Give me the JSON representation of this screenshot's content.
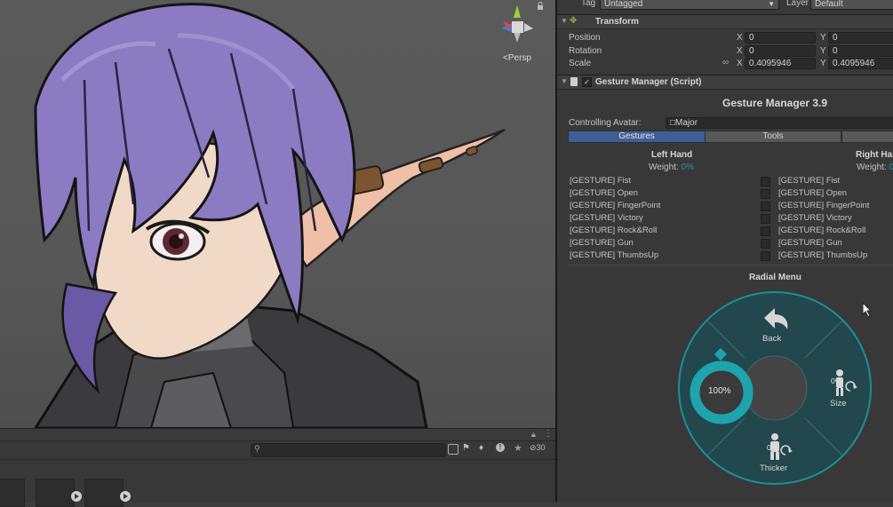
{
  "scene": {
    "persp_label": "Persp"
  },
  "bottom_panel": {
    "visibility_count": "30"
  },
  "inspector": {
    "tag_label": "Tag",
    "tag_value": "Untagged",
    "layer_label": "Layer",
    "layer_value": "Default",
    "transform": {
      "title": "Transform",
      "position_label": "Position",
      "rotation_label": "Rotation",
      "scale_label": "Scale",
      "x_label": "X",
      "y_label": "Y",
      "position_x": "0",
      "position_y": "0",
      "rotation_x": "0",
      "rotation_y": "0",
      "scale_x": "0.4095946",
      "scale_y": "0.4095946"
    },
    "gesture_manager": {
      "component_title": "Gesture Manager (Script)",
      "heading": "Gesture Manager 3.9",
      "controlling_label": "Controlling Avatar:",
      "avatar_name": "Major",
      "tabs": [
        {
          "label": "Gestures",
          "active": true
        },
        {
          "label": "Tools",
          "active": false
        },
        {
          "label": "",
          "active": false
        }
      ],
      "left_hand": {
        "title": "Left Hand",
        "weight_label": "Weight:",
        "weight_value": "0%"
      },
      "right_hand": {
        "title": "Right Hand",
        "weight_label": "Weight:",
        "weight_value": "0"
      },
      "gestures": [
        "[GESTURE] Fist",
        "[GESTURE] Open",
        "[GESTURE] FingerPoint",
        "[GESTURE] Victory",
        "[GESTURE] Rock&Roll",
        "[GESTURE] Gun",
        "[GESTURE] ThumbsUp"
      ],
      "radial_menu": {
        "title": "Radial Menu",
        "back_label": "Back",
        "size_label": "Size",
        "size_value": "0%",
        "thicker_label": "Thicker",
        "thicker_value": "0%",
        "dial_value": "100%",
        "dial_fraction": 1.0
      }
    }
  },
  "colors": {
    "accent_teal": "#1fa3ad",
    "tab_active": "#3e5f96",
    "weight_teal": "#1f9aa6"
  }
}
